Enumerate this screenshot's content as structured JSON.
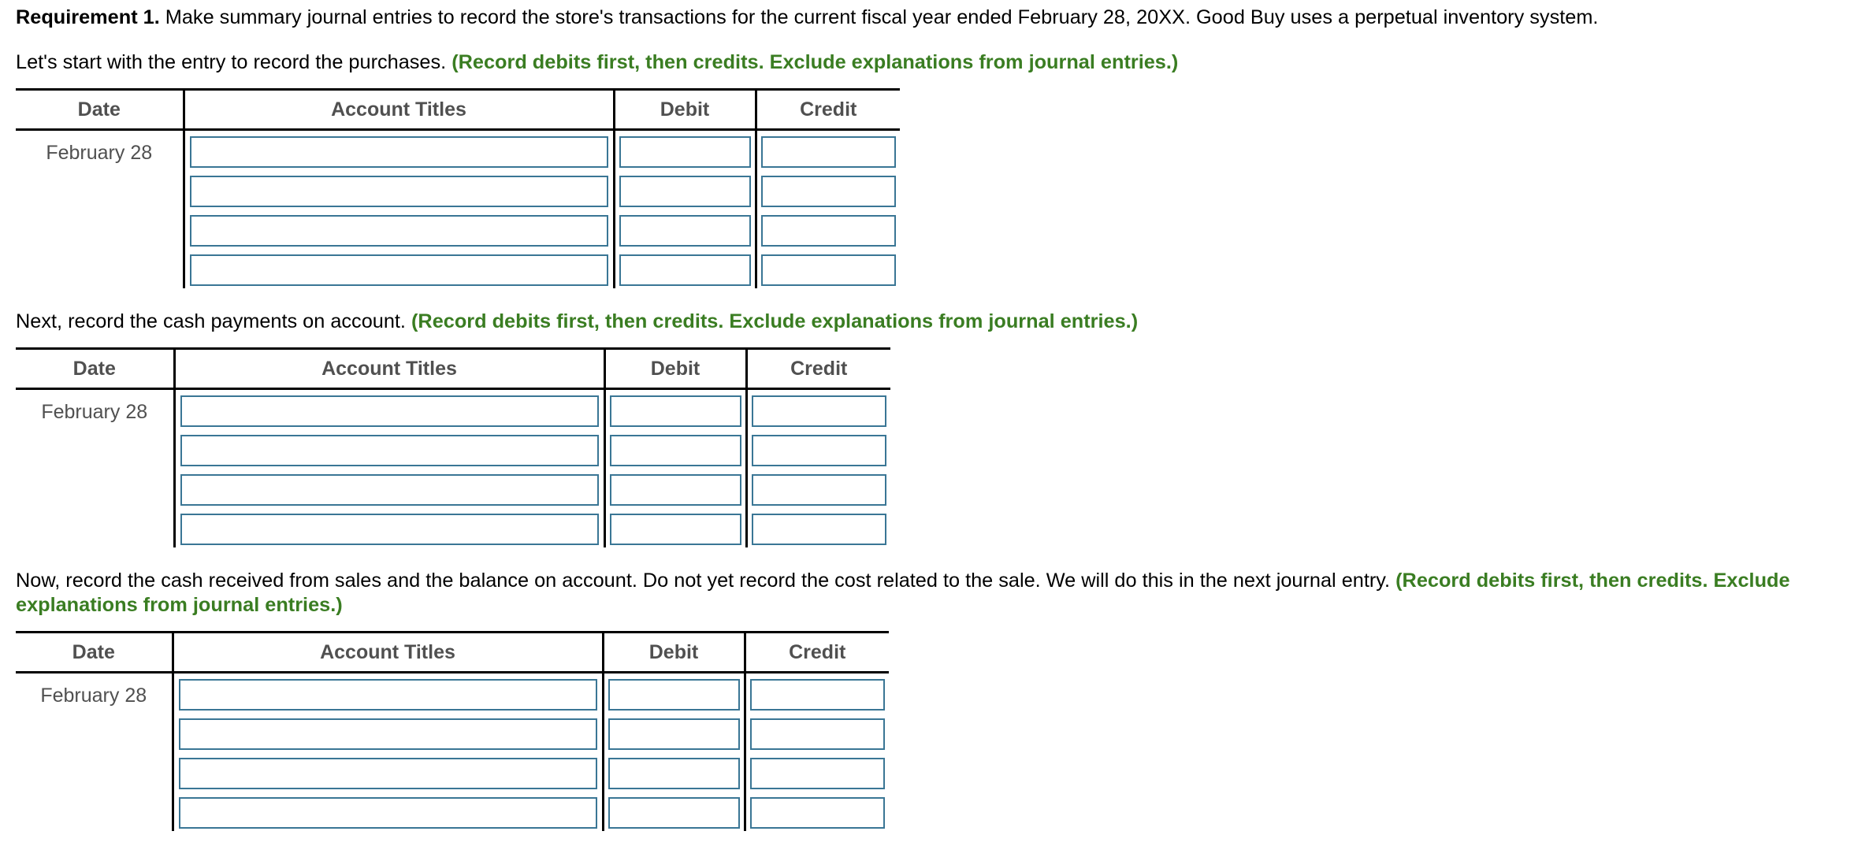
{
  "requirement": {
    "label": "Requirement 1.",
    "text": " Make summary journal entries to record the store's transactions for the current fiscal year ended February 28, 20XX. Good Buy uses a perpetual inventory system."
  },
  "instruction_green": "(Record debits first, then credits. Exclude explanations from journal entries.)",
  "colors": {
    "instruction": "#3a7d22",
    "header_text": "#505050",
    "input_border": "#3a7695"
  },
  "sections": [
    {
      "prompt": "Let's start with the entry to record the purchases. ",
      "instruction": "(Record debits first, then credits. Exclude explanations from journal entries.)",
      "table": {
        "headers": [
          "Date",
          "Account Titles",
          "Debit",
          "Credit"
        ],
        "date": "February 28",
        "rows": [
          {
            "account": "",
            "debit": "",
            "credit": ""
          },
          {
            "account": "",
            "debit": "",
            "credit": ""
          },
          {
            "account": "",
            "debit": "",
            "credit": ""
          },
          {
            "account": "",
            "debit": "",
            "credit": ""
          }
        ]
      }
    },
    {
      "prompt": "Next, record the cash payments on account. ",
      "instruction": "(Record debits first, then credits. Exclude explanations from journal entries.)",
      "table": {
        "headers": [
          "Date",
          "Account Titles",
          "Debit",
          "Credit"
        ],
        "date": "February 28",
        "rows": [
          {
            "account": "",
            "debit": "",
            "credit": ""
          },
          {
            "account": "",
            "debit": "",
            "credit": ""
          },
          {
            "account": "",
            "debit": "",
            "credit": ""
          },
          {
            "account": "",
            "debit": "",
            "credit": ""
          }
        ]
      }
    },
    {
      "prompt": "Now, record the cash received from sales and the balance on account. Do not yet record the cost related to the sale. We will do this in the next journal entry. ",
      "instruction": "(Record debits first, then credits. Exclude explanations from journal entries.)",
      "table": {
        "headers": [
          "Date",
          "Account Titles",
          "Debit",
          "Credit"
        ],
        "date": "February 28",
        "rows": [
          {
            "account": "",
            "debit": "",
            "credit": ""
          },
          {
            "account": "",
            "debit": "",
            "credit": ""
          },
          {
            "account": "",
            "debit": "",
            "credit": ""
          },
          {
            "account": "",
            "debit": "",
            "credit": ""
          }
        ]
      }
    }
  ]
}
